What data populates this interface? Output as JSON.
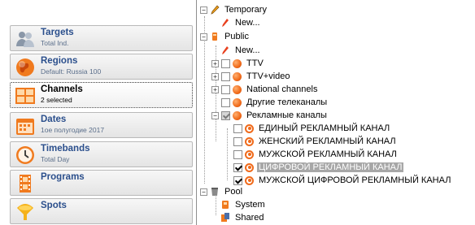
{
  "nav": {
    "items": [
      {
        "title": "Targets",
        "subtitle": "Total Ind.",
        "icon": "targets-people-icon"
      },
      {
        "title": "Regions",
        "subtitle": "Default: Russia 100",
        "icon": "globe-icon"
      },
      {
        "title": "Channels",
        "subtitle": "2 selected",
        "icon": "channels-grid-icon",
        "active": true
      },
      {
        "title": "Dates",
        "subtitle": "1ое полугодие 2017",
        "icon": "calendar-icon"
      },
      {
        "title": "Timebands",
        "subtitle": "Total Day",
        "icon": "clock-icon"
      },
      {
        "title": "Programs",
        "subtitle": "",
        "icon": "film-icon"
      },
      {
        "title": "Spots",
        "subtitle": "",
        "icon": "spots-icon"
      }
    ]
  },
  "tree": {
    "temporary": {
      "label": "Temporary",
      "new_label": "New..."
    },
    "public": {
      "label": "Public",
      "new_label": "New...",
      "groups": [
        "TTV",
        "TTV+video",
        "National channels",
        "Другие телеканалы"
      ],
      "ad_group": {
        "label": "Рекламные каналы",
        "channels": [
          {
            "label": "ЕДИНЫЙ РЕКЛАМНЫЙ КАНАЛ",
            "checked": false
          },
          {
            "label": "ЖЕНСКИЙ РЕКЛАМНЫЙ КАНАЛ",
            "checked": false
          },
          {
            "label": "МУЖСКОЙ РЕКЛАМНЫЙ КАНАЛ",
            "checked": false
          },
          {
            "label": "ЦИФРОВОЙ РЕКЛАМНЫЙ КАНАЛ",
            "checked": true,
            "selected": true
          },
          {
            "label": "МУЖСКОЙ ЦИФРОВОЙ РЕКЛАМНЫЙ КАНАЛ",
            "checked": true
          }
        ]
      }
    },
    "pool": {
      "label": "Pool",
      "children": [
        "System",
        "Shared"
      ]
    }
  },
  "colors": {
    "accent_orange": "#f06a1a",
    "nav_title": "#2b4f8c",
    "selection": "#a7a7a7"
  }
}
